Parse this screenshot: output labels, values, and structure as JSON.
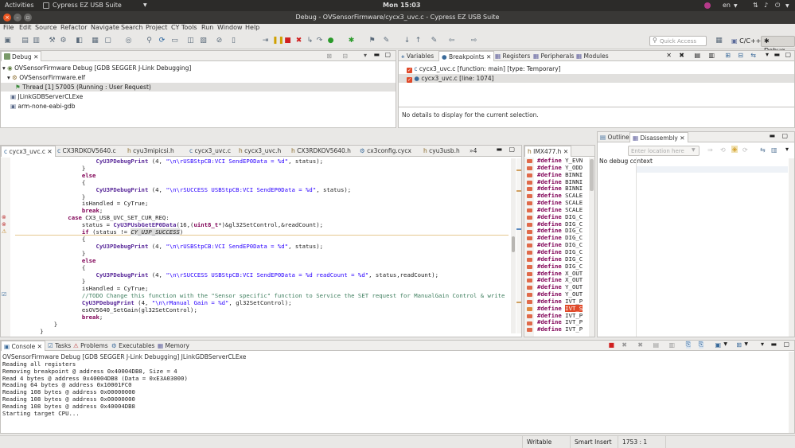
{
  "system_bar": {
    "activities": "Activities",
    "app_name": "Cypress EZ USB Suite",
    "clock": "Mon 15:03",
    "lang": "en"
  },
  "window": {
    "title": "Debug - OVSensorFirmware/cycx3_uvc.c - Cypress EZ USB Suite"
  },
  "menu": [
    "File",
    "Edit",
    "Source",
    "Refactor",
    "Navigate",
    "Search",
    "Project",
    "CY Tools",
    "Run",
    "Window",
    "Help"
  ],
  "toolbar": {
    "quick_access_placeholder": "Quick Access",
    "perspective_cc": "C/C++",
    "perspective_debug": "Debug"
  },
  "debug_view": {
    "tab": "Debug",
    "tree": [
      "OVSensorFirmware Debug [GDB SEGGER J-Link Debugging]",
      "OVSensorFirmware.elf",
      "Thread [1] 57005 (Running : User Request)",
      "JLinkGDBServerCLExe",
      "arm-none-eabi-gdb"
    ]
  },
  "breakpoints_view": {
    "tabs": [
      "Variables",
      "Breakpoints",
      "Registers",
      "Peripherals",
      "Modules"
    ],
    "items": [
      "cycx3_uvc.c [function: main] [type: Temporary]",
      "cycx3_uvc.c [line: 1074]"
    ],
    "details": "No details to display for the current selection."
  },
  "editor": {
    "tabs": [
      "cycx3_uvc.c",
      "CX3RDKOV5640.c",
      "cyu3mipicsi.h",
      "cycx3_uvc.c",
      "cycx3_uvc.h",
      "CX3RDKOV5640.h",
      "cx3config.cycx",
      "cyu3usb.h",
      "»4"
    ]
  },
  "header_view": {
    "tab": "IMX477.h"
  },
  "outline_view": {
    "tabs": [
      "Outline",
      "Disassembly"
    ],
    "location_placeholder": "Enter location here",
    "no_context": "No debug context"
  },
  "console_view": {
    "tabs": [
      "Console",
      "Tasks",
      "Problems",
      "Executables",
      "Memory"
    ],
    "header": "OVSensorFirmware Debug [GDB SEGGER J-Link Debugging] JLinkGDBServerCLExe",
    "lines": [
      "Reading all registers",
      "Removing breakpoint @ address 0x40004DB8, Size = 4",
      "Read 4 bytes @ address 0x40004DB8 (Data = 0xE3A03000)",
      "Reading 64 bytes @ address 0x10001FC0",
      "Reading 108 bytes @ address 0x00000000",
      "Reading 108 bytes @ address 0x00000000",
      "Reading 108 bytes @ address 0x40004DB8",
      "Starting target CPU..."
    ]
  },
  "status_bar": {
    "writable": "Writable",
    "insert_mode": "Smart Insert",
    "position": "1753 : 1"
  }
}
